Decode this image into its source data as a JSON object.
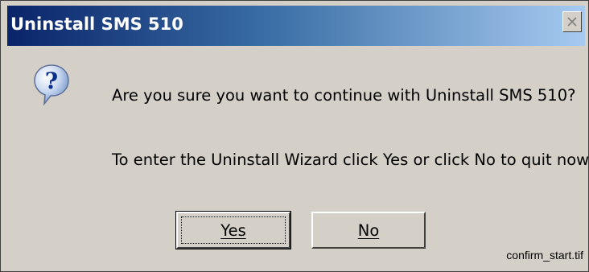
{
  "window": {
    "title": "Uninstall SMS 510",
    "close_icon": "close-icon"
  },
  "dialog": {
    "icon": "question-icon",
    "message": "Are you sure you want to continue with Uninstall SMS 510?",
    "instruction": "To enter the Uninstall Wizard click Yes or click No to quit now"
  },
  "buttons": {
    "yes_label": "Yes",
    "no_label": "No"
  },
  "caption": "confirm_start.tif",
  "colors": {
    "title_gradient_start": "#0a246a",
    "title_gradient_end": "#a6caf0",
    "dialog_background": "#d4d0c8"
  }
}
